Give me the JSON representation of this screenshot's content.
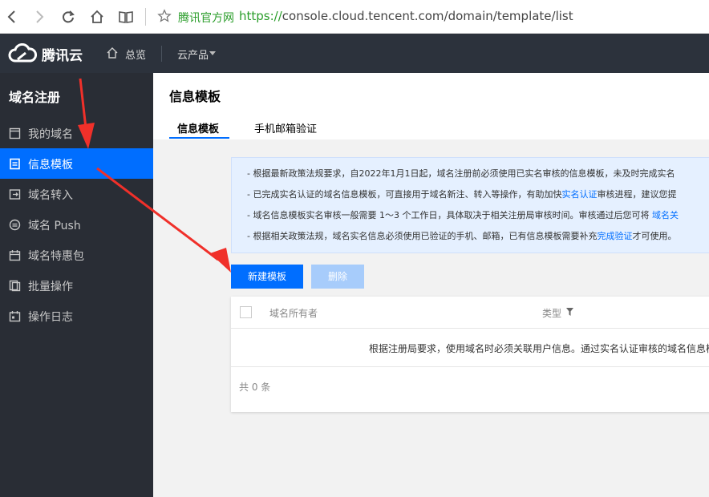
{
  "browser": {
    "site_name": "腾讯官方网",
    "url_scheme": "https://",
    "url_rest": "console.cloud.tencent.com/domain/template/list"
  },
  "topnav": {
    "brand": "腾讯云",
    "overview": "总览",
    "products": "云产品"
  },
  "sidebar": {
    "title": "域名注册",
    "items": [
      {
        "label": "我的域名",
        "icon": "window-icon"
      },
      {
        "label": "信息模板",
        "icon": "document-icon",
        "active": true
      },
      {
        "label": "域名转入",
        "icon": "transfer-icon"
      },
      {
        "label": "域名 Push",
        "icon": "push-icon"
      },
      {
        "label": "域名特惠包",
        "icon": "calendar-icon"
      },
      {
        "label": "批量操作",
        "icon": "copy-icon"
      },
      {
        "label": "操作日志",
        "icon": "log-icon"
      }
    ]
  },
  "main": {
    "title": "信息模板",
    "tabs": [
      {
        "label": "信息模板",
        "active": true
      },
      {
        "label": "手机邮箱验证"
      }
    ],
    "notice": {
      "line1": "- 根据最新政策法规要求，自2022年1月1日起，域名注册前必须使用已实名审核的信息模板，未及时完成实名",
      "line2_a": "- 已完成实名认证的域名信息模板，可直接用于域名新注、转入等操作，有助加快",
      "line2_link": "实名认证",
      "line2_b": "审核进程，建议您提",
      "line3_a": "- 域名信息模板实名审核一般需要 1～3 个工作日，具体取决于相关注册局审核时间。审核通过后您可将 ",
      "line3_link": "域名关",
      "line4_a": "- 根据相关政策法规，域名实名信息必须使用已验证的手机、邮箱，已有信息模板需要补充",
      "line4_link": "完成验证",
      "line4_b": "才可使用。"
    },
    "buttons": {
      "new_template": "新建模板",
      "delete": "删除"
    },
    "table": {
      "col_owner": "域名所有者",
      "col_type": "类型",
      "empty_text": "根据注册局要求，使用域名时必须关联用户信息。通过实名认证审核的域名信息模",
      "footer": "共 0 条"
    }
  },
  "colors": {
    "accent": "#006eff",
    "sidebar_bg": "#292d35",
    "topnav_bg": "#2c323c",
    "annotation_arrow": "#f0302a"
  }
}
